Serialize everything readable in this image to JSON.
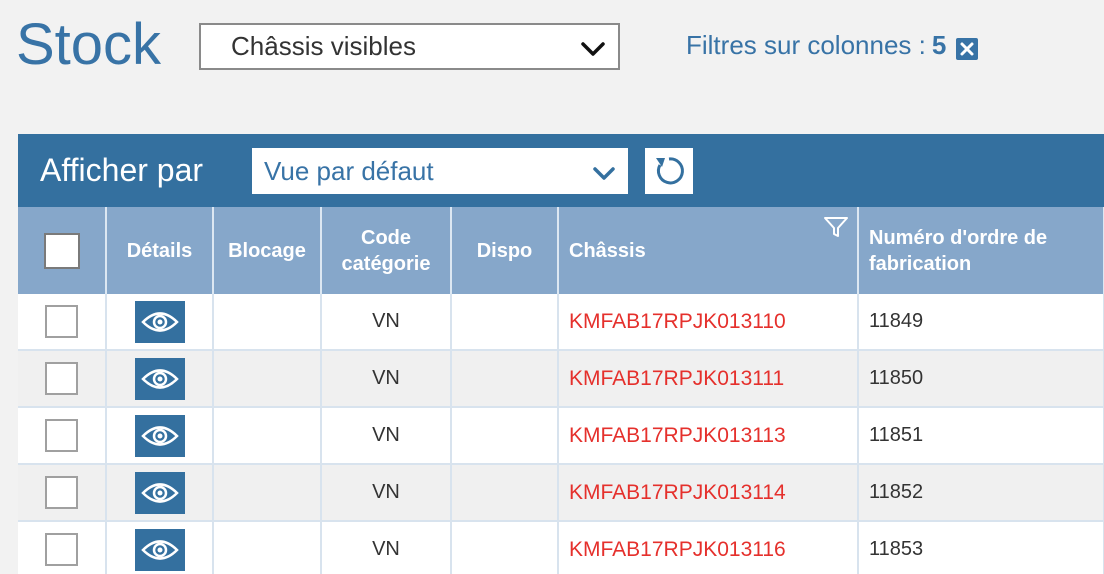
{
  "header": {
    "title": "Stock",
    "view_selected": "Châssis visibles",
    "filters_label": "Filtres sur colonnes :",
    "filters_count": "5"
  },
  "toolbar": {
    "label": "Afficher par",
    "group_selected": "Vue par défaut"
  },
  "table": {
    "columns": {
      "details": "Détails",
      "blocage": "Blocage",
      "code_categorie": "Code catégorie",
      "dispo": "Dispo",
      "chassis": "Châssis",
      "numero_ordre": "Numéro d'ordre de fabrication"
    },
    "rows": [
      {
        "code": "VN",
        "chassis": "KMFAB17RPJK013110",
        "order": "11849"
      },
      {
        "code": "VN",
        "chassis": "KMFAB17RPJK013111",
        "order": "11850"
      },
      {
        "code": "VN",
        "chassis": "KMFAB17RPJK013113",
        "order": "11851"
      },
      {
        "code": "VN",
        "chassis": "KMFAB17RPJK013114",
        "order": "11852"
      },
      {
        "code": "VN",
        "chassis": "KMFAB17RPJK013116",
        "order": "11853"
      }
    ]
  },
  "icons": {
    "chevron": "chevron-down-icon",
    "clear_filters": "close-icon",
    "refresh": "refresh-icon",
    "details": "eye-icon",
    "column_filter": "funnel-icon"
  },
  "colors": {
    "primary": "#34709f",
    "title": "#3873a6",
    "header_cells": "#86a7ca",
    "chassis_text": "#e5302c"
  }
}
